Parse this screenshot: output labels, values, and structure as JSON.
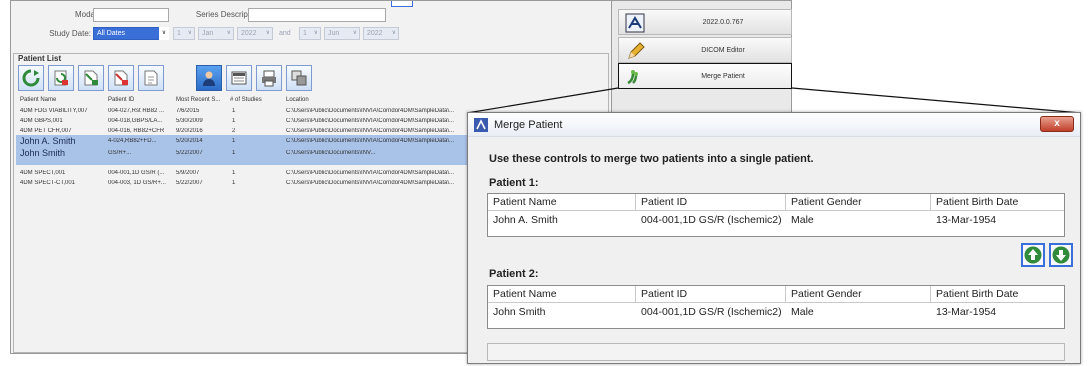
{
  "app": {
    "modality_label": "Modality:",
    "series_desc_label": "Series Description:",
    "study_date_label": "Study Date:",
    "study_date_value": "All Dates",
    "date_from": {
      "day": "1",
      "month": "Jan",
      "year": "2022"
    },
    "date_and": "and",
    "date_to": {
      "day": "1",
      "month": "Jun",
      "year": "2022"
    }
  },
  "patient_list": {
    "title": "Patient List",
    "columns": [
      "Patient Name",
      "Patient ID",
      "Most Recent S...",
      "# of Studies",
      "Location"
    ],
    "rows": [
      {
        "name": "4DM FDG VIABILITY,007",
        "id": "004-027,Rst RB82 ...",
        "date": "7/6/2015",
        "studies": "1",
        "location": "C:\\Users\\Public\\Documents\\INVIA\\Corridor4DM\\SampleData\\..."
      },
      {
        "name": "4DM GBPS,001",
        "id": "004-018,GBPS/LA...",
        "date": "5/30/2009",
        "studies": "1",
        "location": "C:\\Users\\Public\\Documents\\INVIA\\Corridor4DM\\SampleData\\..."
      },
      {
        "name": "4DM PET CFR,007",
        "id": "004-016, RB82+CFR",
        "date": "9/20/2016",
        "studies": "2",
        "location": "C:\\Users\\Public\\Documents\\INVIA\\Corridor4DM\\SampleData\\..."
      },
      {
        "name": "John A. Smith",
        "id": "4-024,RB82+FD...",
        "date": "5/20/2014",
        "studies": "1",
        "location": "C:\\Users\\Public\\Documents\\INVIA\\Corridor4DM\\SampleData\\..."
      },
      {
        "name": "John Smith",
        "id": "GS/R+...",
        "date": "5/22/2007",
        "studies": "1",
        "location": "C:\\Users\\Public\\Documents\\INV..."
      },
      {
        "name": "4DM SPECT,001",
        "id": "004-001,1D GS/R (...",
        "date": "5/9/2007",
        "studies": "1",
        "location": "C:\\Users\\Public\\Documents\\INVIA\\Corridor4DM\\SampleData\\..."
      },
      {
        "name": "4DM SPECT-CT,001",
        "id": "004-003, 1D GS/R+...",
        "date": "5/22/2007",
        "studies": "1",
        "location": "C:\\Users\\Public\\Documents\\INVIA\\Corridor4DM\\SampleData\\..."
      }
    ]
  },
  "right_panel": {
    "version": "2022.0.0.767",
    "dicom_editor": "DICOM Editor",
    "merge_patient": "Merge Patient"
  },
  "dialog": {
    "title": "Merge Patient",
    "close": "x",
    "instructions": "Use these controls to merge two patients into a single patient.",
    "columns": [
      "Patient Name",
      "Patient ID",
      "Patient Gender",
      "Patient Birth Date"
    ],
    "patient1": {
      "label": "Patient 1:",
      "name": "John A. Smith",
      "id": "004-001,1D GS/R (Ischemic2)",
      "gender": "Male",
      "birth_date": "13-Mar-1954"
    },
    "patient2": {
      "label": "Patient 2:",
      "name": "John Smith",
      "id": "004-001,1D GS/R (Ischemic2)",
      "gender": "Male",
      "birth_date": "13-Mar-1954"
    }
  },
  "colors": {
    "selection": "#a9c3e8",
    "accent": "#3a6ed8",
    "arrow_green": "#2f8a3a"
  }
}
